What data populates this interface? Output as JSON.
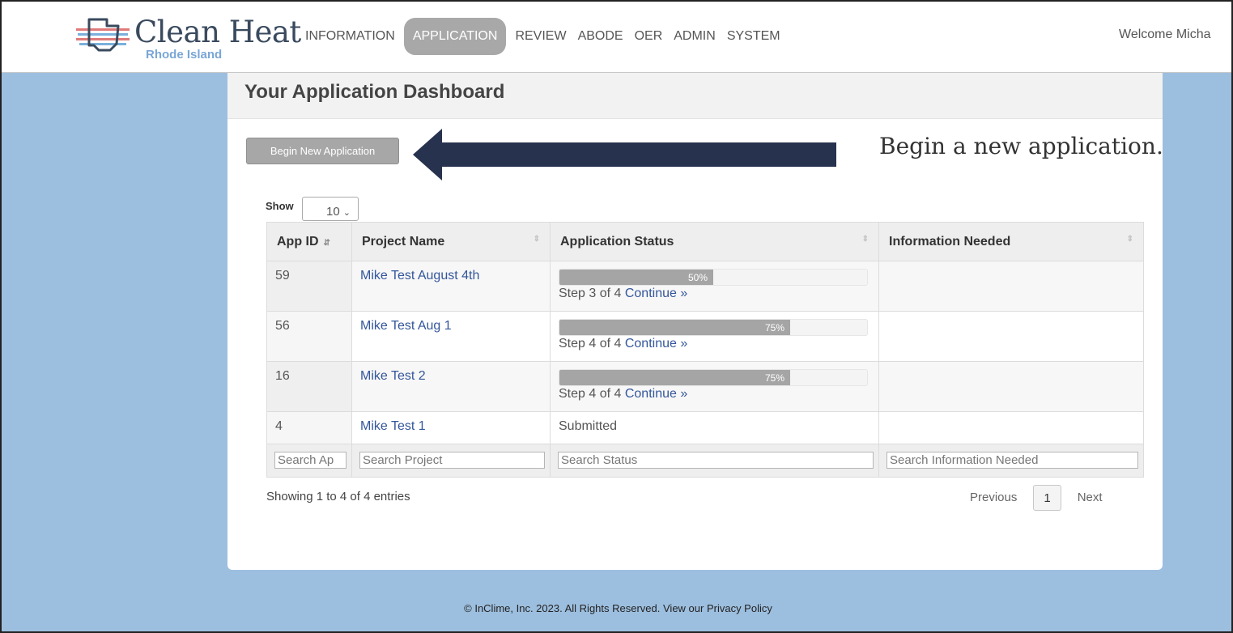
{
  "brand": {
    "title": "Clean Heat",
    "subtitle": "Rhode Island"
  },
  "nav": {
    "items": [
      {
        "label": "INFORMATION",
        "active": false
      },
      {
        "label": "APPLICATION",
        "active": true
      },
      {
        "label": "REVIEW",
        "active": false
      },
      {
        "label": "ABODE",
        "active": false
      },
      {
        "label": "OER",
        "active": false
      },
      {
        "label": "ADMIN",
        "active": false
      },
      {
        "label": "SYSTEM",
        "active": false
      }
    ],
    "welcome": "Welcome Micha"
  },
  "panel": {
    "title": "Your Application Dashboard",
    "begin_button": "Begin New Application",
    "annotation": "Begin a new application."
  },
  "table": {
    "show_label": "Show",
    "show_value": "10",
    "columns": [
      "App ID",
      "Project Name",
      "Application Status",
      "Information Needed"
    ],
    "rows": [
      {
        "app_id": "59",
        "project": "Mike Test August 4th",
        "progress": 50,
        "progress_label": "50%",
        "step_text": "Step 3 of 4",
        "continue": "Continue »",
        "status": "",
        "info": ""
      },
      {
        "app_id": "56",
        "project": "Mike Test Aug 1",
        "progress": 75,
        "progress_label": "75%",
        "step_text": "Step 4 of 4",
        "continue": "Continue »",
        "status": "",
        "info": ""
      },
      {
        "app_id": "16",
        "project": "Mike Test 2",
        "progress": 75,
        "progress_label": "75%",
        "step_text": "Step 4 of 4",
        "continue": "Continue »",
        "status": "",
        "info": ""
      },
      {
        "app_id": "4",
        "project": "Mike Test 1",
        "progress": null,
        "progress_label": "",
        "step_text": "",
        "continue": "",
        "status": "Submitted",
        "info": ""
      }
    ],
    "filters": {
      "app_id": "Search Ap",
      "project": "Search Project",
      "status": "Search Status",
      "info": "Search Information Needed"
    },
    "showing": "Showing 1 to 4 of 4 entries",
    "pager": {
      "previous": "Previous",
      "page": "1",
      "next": "Next"
    }
  },
  "footer": "© InClime, Inc. 2023. All Rights Reserved. View our Privacy Policy",
  "colors": {
    "background": "#9dbfdf",
    "active_nav": "#a8a8a8",
    "arrow": "#27324f",
    "link": "#33569b"
  }
}
